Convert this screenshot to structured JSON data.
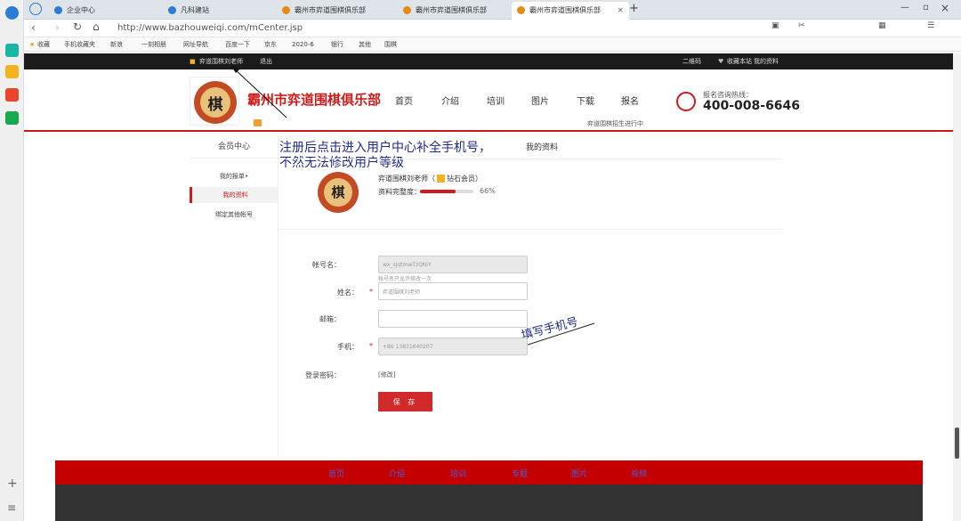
{
  "browser": {
    "tabs": [
      {
        "label": "企业中心",
        "icon": "app-icon",
        "color": "#2b7bd8"
      },
      {
        "label": "凡科建站",
        "icon": "app-icon",
        "color": "#2b7bd8"
      },
      {
        "label": "霸州市弈道围棋俱乐部",
        "icon": "site-icon",
        "color": "#e58a14"
      },
      {
        "label": "霸州市弈道围棋俱乐部",
        "icon": "site-icon",
        "color": "#e58a14"
      },
      {
        "label": "霸州市弈道围棋俱乐部",
        "icon": "site-icon",
        "color": "#e58a14"
      }
    ],
    "new_tab": "+",
    "address": "http://www.bazhouweiqi.com/mCenter.jsp",
    "bookmarks": [
      "收藏",
      "手机收藏夹",
      "新浪",
      "一刻相册",
      "网址导航",
      "百度一下",
      "京东",
      "2020-6",
      "银行",
      "其他",
      "围棋"
    ]
  },
  "site": {
    "topbar": {
      "user": "弈道围棋刘老师",
      "logout": "退出",
      "qr": "二维码",
      "fav": "收藏本站",
      "profile": "我的资料"
    },
    "logo_char": "棋",
    "name": "霸州市弈道围棋俱乐部",
    "nav": [
      "首页",
      "介绍",
      "培训",
      "图片",
      "下载",
      "报名"
    ],
    "recruiting": "弈道围棋招生进行中",
    "hotline_label": "报名咨询热线：",
    "hotline": "400-008-6646"
  },
  "sidebar": {
    "title": "会员中心",
    "items": [
      {
        "label": "我的报单"
      },
      {
        "label": "我的资料"
      },
      {
        "label": "绑定其他帐号"
      }
    ]
  },
  "annotations": {
    "line1": "注册后点击进入用户中心补全手机号，",
    "line2": "不然无法修改用户等级",
    "phone_note": "填写手机号"
  },
  "profile": {
    "section_title": "我的资料",
    "username": "弈道围棋刘老师",
    "level": "钻石会员",
    "completeness_label": "资料完整度：",
    "completeness": 66,
    "completeness_text": "66%"
  },
  "form": {
    "account_label": "帐号名：",
    "account_value": "wx_sJqtmwTzQNiY",
    "account_hint": "帐号名只允许修改一次",
    "name_label": "姓名：",
    "name_value": "弈道围棋刘老师",
    "email_label": "邮箱：",
    "email_value": "",
    "phone_label": "手机：",
    "phone_value": "+86 13831640207",
    "password_label": "登录密码：",
    "password_action": "[修改]",
    "save_label": "保 存"
  },
  "footer": {
    "nav": [
      "首页",
      "介绍",
      "培训",
      "专题",
      "图片",
      "视频"
    ]
  },
  "colors": {
    "brand_red": "#c81c1c",
    "annotation_blue": "#1f2a8a"
  }
}
